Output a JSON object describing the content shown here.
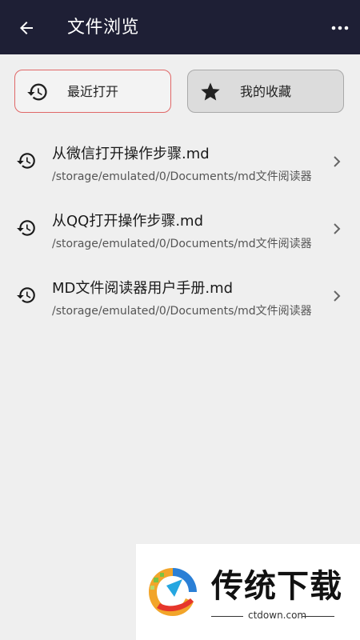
{
  "app": {
    "title": "文件浏览",
    "colors": {
      "topbar": "#1e1f35",
      "background": "#efefef",
      "tab_active_border": "#e06767",
      "tab_inactive_bg": "#dcdcdc"
    }
  },
  "tabs": [
    {
      "label": "最近打开",
      "icon": "history-icon",
      "active": true
    },
    {
      "label": "我的收藏",
      "icon": "star-icon",
      "active": false
    }
  ],
  "files": [
    {
      "name": "从微信打开操作步骤.md",
      "path": "/storage/emulated/0/Documents/md文件阅读器"
    },
    {
      "name": "从QQ打开操作步骤.md",
      "path": "/storage/emulated/0/Documents/md文件阅读器"
    },
    {
      "name": "MD文件阅读器用户手册.md",
      "path": "/storage/emulated/0/Documents/md文件阅读器"
    }
  ],
  "watermark": {
    "brand": "传统下载",
    "domain": "ctdown.com"
  }
}
